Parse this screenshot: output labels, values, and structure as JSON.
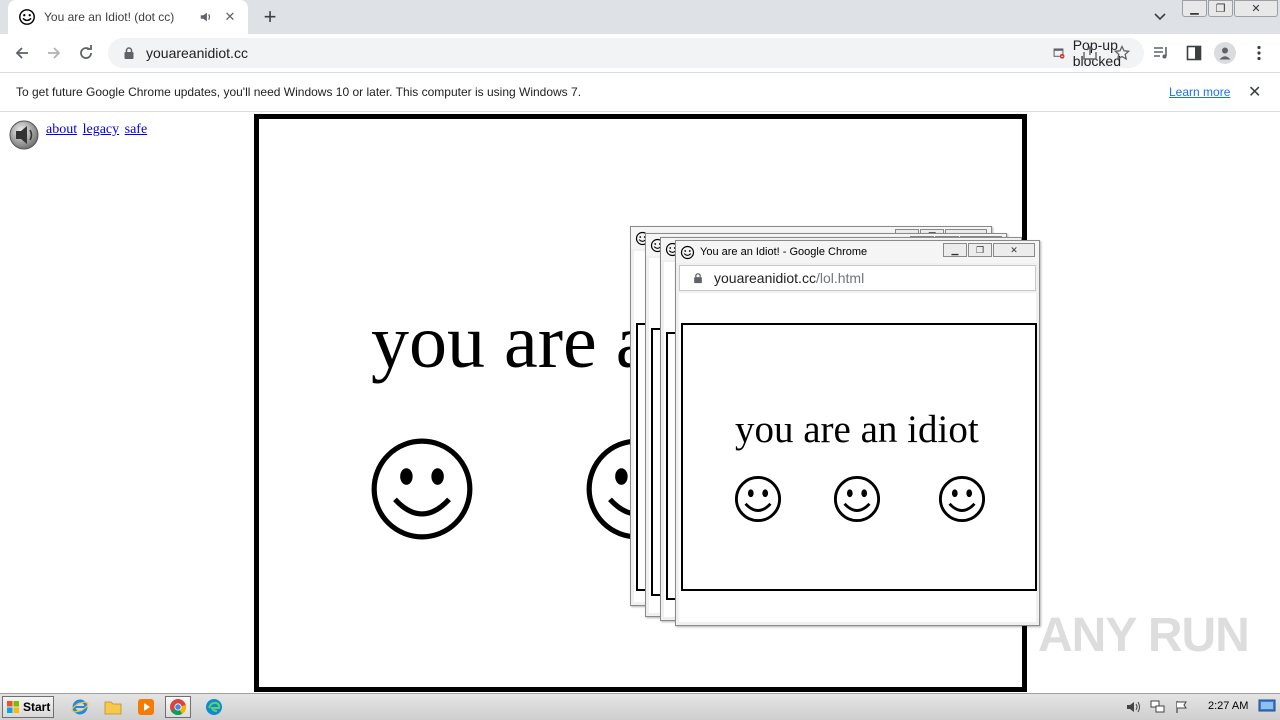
{
  "browser": {
    "tab": {
      "title": "You are an Idiot! (dot cc)"
    },
    "omnibox": {
      "url": "youareanidiot.cc"
    },
    "popup_blocked_label": "Pop-up blocked"
  },
  "infobar": {
    "message": "To get future Google Chrome updates, you'll need Windows 10 or later. This computer is using Windows 7.",
    "learn_more": "Learn more"
  },
  "page": {
    "links": [
      "about",
      "legacy",
      "safe"
    ],
    "headline": "you are an idiot"
  },
  "popup": {
    "window_title": "You are an Idiot! - Google Chrome",
    "url_host": "youareanidiot.cc",
    "url_path": "/lol.html",
    "headline": "you are an idiot"
  },
  "watermark": "ANY RUN",
  "taskbar": {
    "start_label": "Start",
    "clock": "2:27 AM"
  }
}
